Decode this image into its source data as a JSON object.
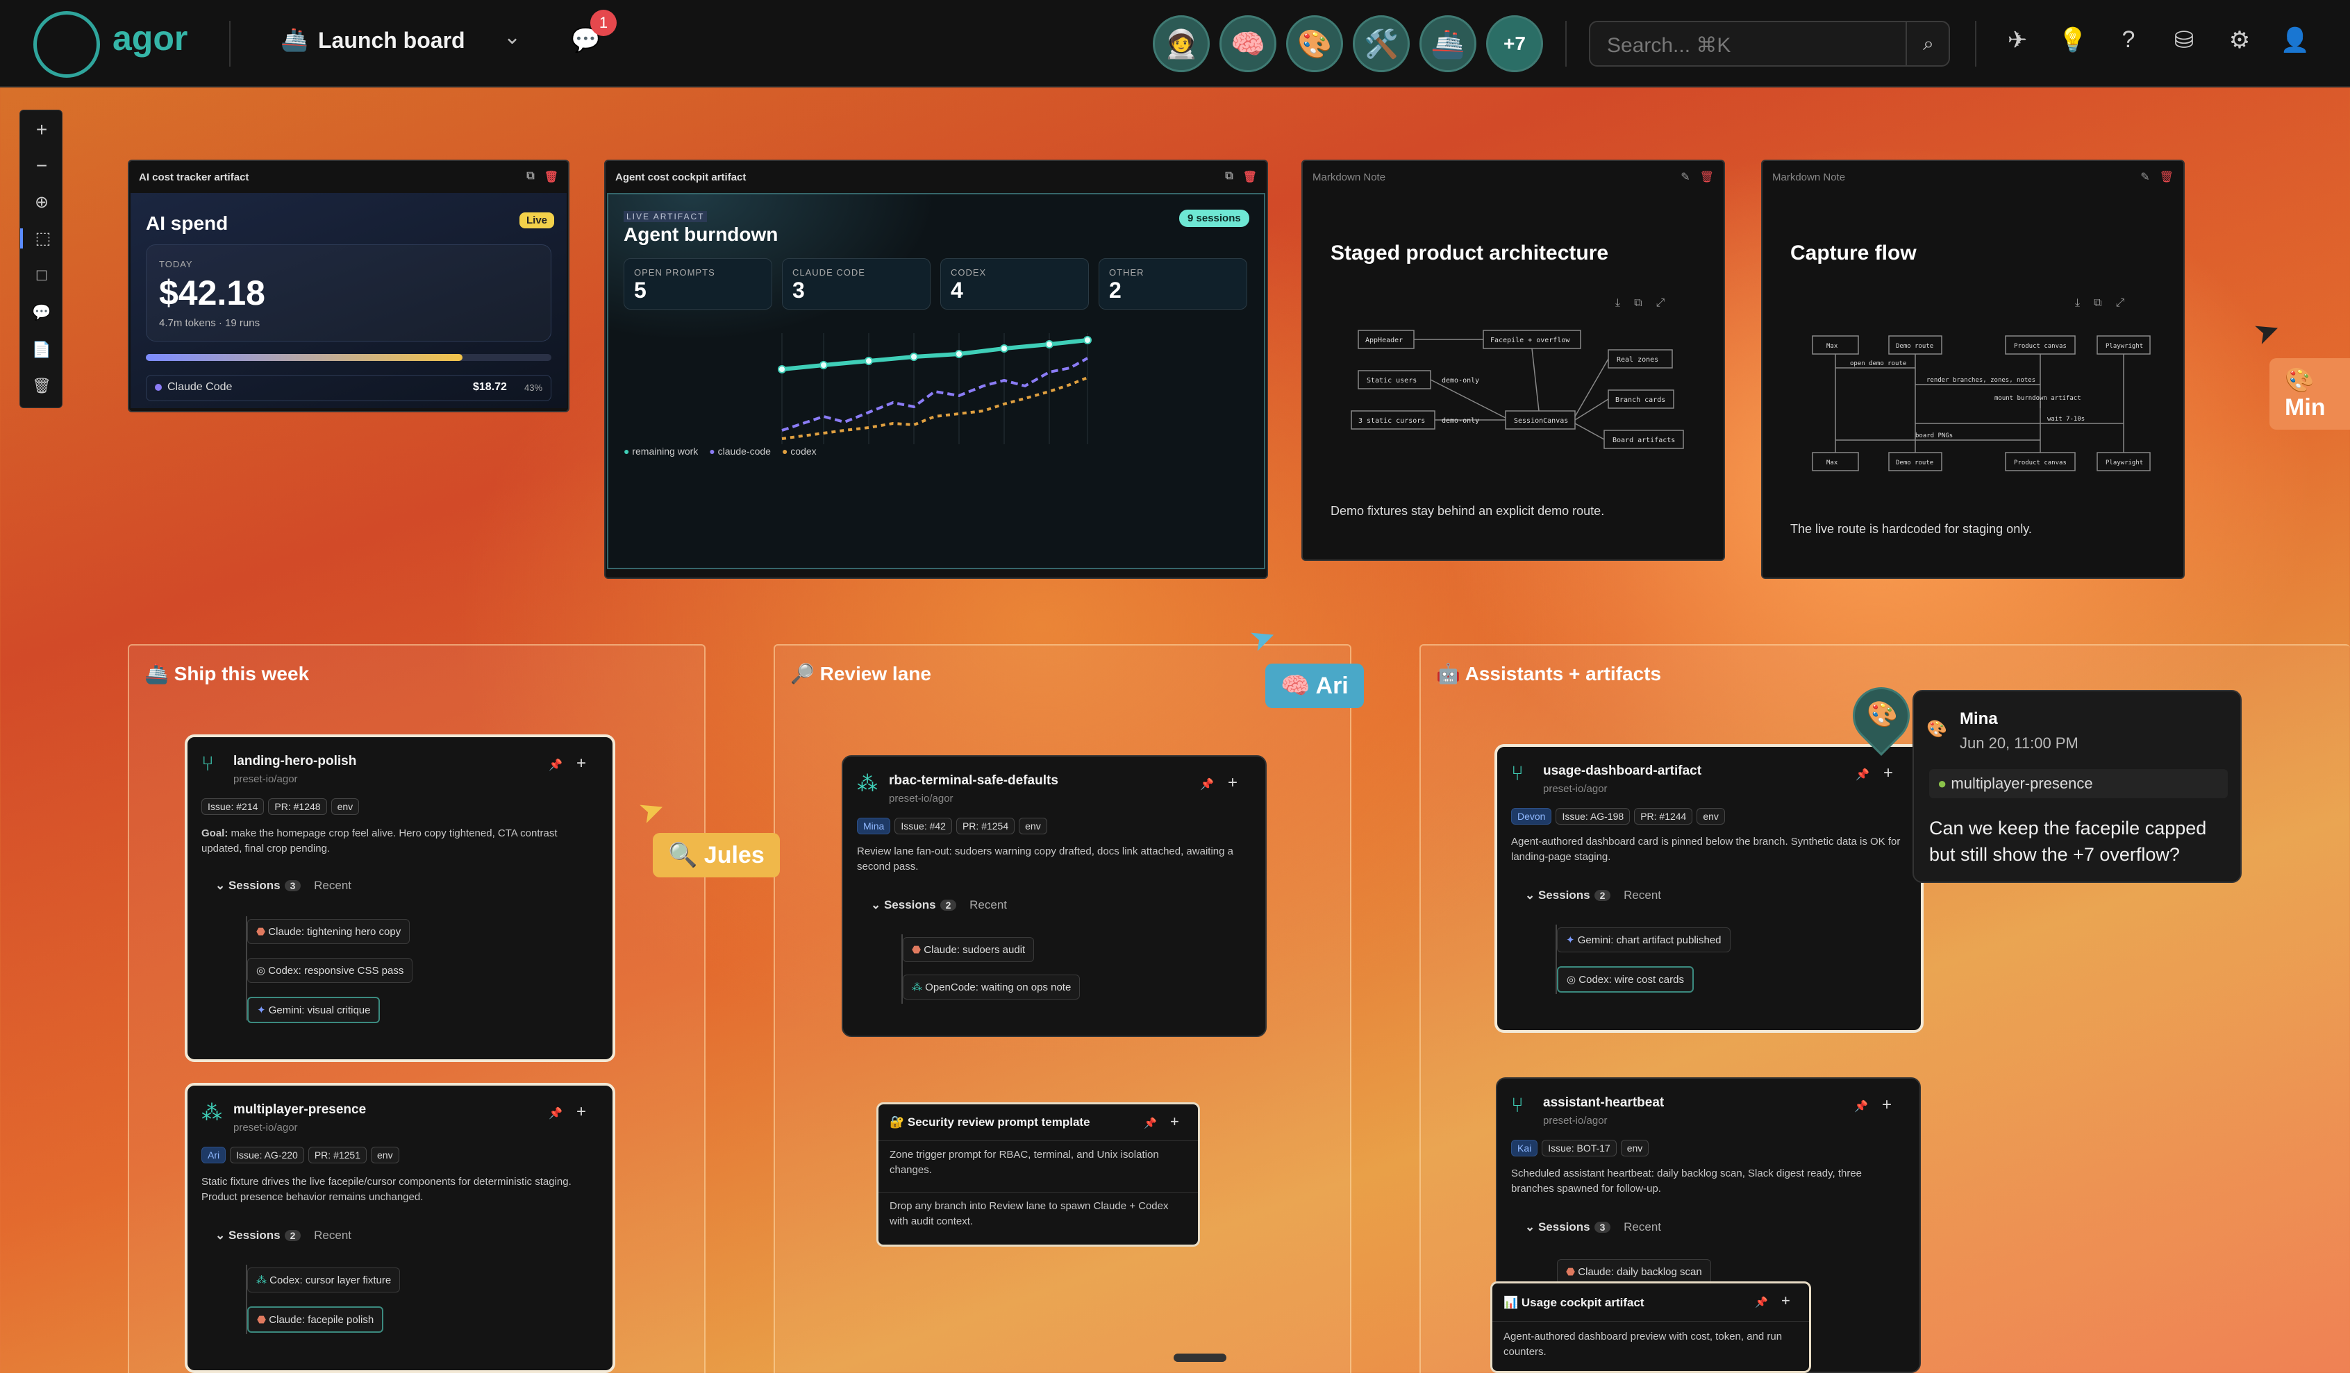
{
  "app": {
    "name": "agor",
    "board": "Launch board",
    "notif_count": "1",
    "search_placeholder": "Search... ⌘K",
    "avatar_more": "+7"
  },
  "topbar_avatars": [
    "🧑‍🚀",
    "🧠",
    "🎨",
    "🛠️",
    "🚢"
  ],
  "spend": {
    "panel_title": "AI cost tracker artifact",
    "title": "AI spend",
    "live": "Live",
    "today_label": "TODAY",
    "amount": "$42.18",
    "sub": "4.7m tokens · 19 runs",
    "progress": 0.78,
    "row_label": "Claude Code",
    "row_amount": "$18.72",
    "row_pct": "43%"
  },
  "cockpit": {
    "panel_title": "Agent cost cockpit artifact",
    "eyebrow": "LIVE ARTIFACT",
    "title": "Agent burndown",
    "sessions": "9 sessions",
    "kpis": [
      {
        "label": "OPEN PROMPTS",
        "value": "5"
      },
      {
        "label": "CLAUDE CODE",
        "value": "3"
      },
      {
        "label": "CODEX",
        "value": "4"
      },
      {
        "label": "OTHER",
        "value": "2"
      }
    ],
    "legend": [
      "remaining work",
      "claude-code",
      "codex"
    ],
    "colors": [
      "#3fcfb8",
      "#8b7cf6",
      "#e0a040"
    ]
  },
  "note1": {
    "panel_title": "Markdown Note",
    "title": "Staged product architecture",
    "boxes": [
      "AppHeader",
      "Facepile + overflow",
      "Static users",
      "demo-only",
      "3 static cursors",
      "demo-only",
      "SessionCanvas",
      "Real zones",
      "Branch cards",
      "Board artifacts"
    ],
    "footer": "Demo fixtures stay behind an explicit demo route."
  },
  "note2": {
    "panel_title": "Markdown Note",
    "title": "Capture flow",
    "actors": [
      "Max",
      "Demo route",
      "Product canvas",
      "Playwright"
    ],
    "msgs": [
      "open demo route",
      "render branches, zones, notes",
      "mount burndown artifact",
      "wait 7-10s",
      "board PNGs"
    ],
    "footer": "The live route is hardcoded for staging only."
  },
  "zones": {
    "ship": "🚢 Ship this week",
    "review": "🔎 Review lane",
    "assist": "🤖 Assistants + artifacts"
  },
  "cards": {
    "c1": {
      "title": "landing-hero-polish",
      "repo": "preset-io/agor",
      "tags": [
        "Issue: #214",
        "PR: #1248",
        "env"
      ],
      "goal_label": "Goal:",
      "desc": "make the homepage crop feel alive. Hero copy tightened, CTA contrast updated, final crop pending.",
      "sessions_label": "Sessions",
      "count": "3",
      "recent": "Recent",
      "sessions": [
        "Claude: tightening hero copy",
        "Codex: responsive CSS pass",
        "Gemini: visual critique"
      ]
    },
    "c2": {
      "title": "multiplayer-presence",
      "repo": "preset-io/agor",
      "tags": [
        "Ari",
        "Issue: AG-220",
        "PR: #1251",
        "env"
      ],
      "desc": "Static fixture drives the live facepile/cursor components for deterministic staging. Product presence behavior remains unchanged.",
      "sessions_label": "Sessions",
      "count": "2",
      "recent": "Recent",
      "sessions": [
        "Codex: cursor layer fixture",
        "Claude: facepile polish"
      ]
    },
    "c3": {
      "title": "rbac-terminal-safe-defaults",
      "repo": "preset-io/agor",
      "tags": [
        "Mina",
        "Issue: #42",
        "PR: #1254",
        "env"
      ],
      "desc": "Review lane fan-out: sudoers warning copy drafted, docs link attached, awaiting a second pass.",
      "sessions_label": "Sessions",
      "count": "2",
      "recent": "Recent",
      "sessions": [
        "Claude: sudoers audit",
        "OpenCode: waiting on ops note"
      ]
    },
    "c4": {
      "title": "🔐 Security review prompt template",
      "l1": "Zone trigger prompt for RBAC, terminal, and Unix isolation changes.",
      "l2": "Drop any branch into Review lane to spawn Claude + Codex with audit context."
    },
    "c5": {
      "title": "usage-dashboard-artifact",
      "repo": "preset-io/agor",
      "tags": [
        "Devon",
        "Issue: AG-198",
        "PR: #1244",
        "env"
      ],
      "desc": "Agent-authored dashboard card is pinned below the branch. Synthetic data is OK for landing-page staging.",
      "sessions_label": "Sessions",
      "count": "2",
      "recent": "Recent",
      "sessions": [
        "Gemini: chart artifact published",
        "Codex: wire cost cards"
      ]
    },
    "c6": {
      "title": "assistant-heartbeat",
      "repo": "preset-io/agor",
      "tags": [
        "Kai",
        "Issue: BOT-17",
        "env"
      ],
      "desc": "Scheduled assistant heartbeat: daily backlog scan, Slack digest ready, three branches spawned for follow-up.",
      "sessions_label": "Sessions",
      "count": "3",
      "recent": "Recent",
      "sessions": [
        "Claude: daily backlog scan"
      ]
    },
    "c7": {
      "title": "📊 Usage cockpit artifact",
      "desc": "Agent-authored dashboard preview with cost, token, and run counters."
    }
  },
  "comment": {
    "author": "Mina",
    "date": "Jun 20, 11:00 PM",
    "branch": "multiplayer-presence",
    "text": "Can we keep the facepile capped but still show the +7 overflow?"
  },
  "cursors": {
    "jules": "🔍 Jules",
    "ari": "🧠 Ari",
    "min": "🎨 Min"
  }
}
